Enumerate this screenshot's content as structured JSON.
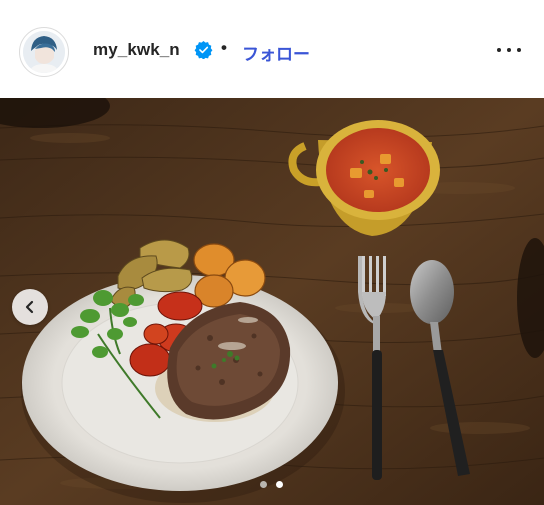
{
  "post_header": {
    "username": "my_kwk_n",
    "separator": "•",
    "follow_label": "フォロー",
    "verified_icon": "verified-badge-icon",
    "more_icon": "more-options-icon"
  },
  "carousel": {
    "prev_icon": "chevron-left-icon",
    "total_images": 2,
    "current_image": 2
  },
  "colors": {
    "follow_blue": "#3a55d6",
    "verified_blue": "#0095f6",
    "text": "#262626"
  }
}
